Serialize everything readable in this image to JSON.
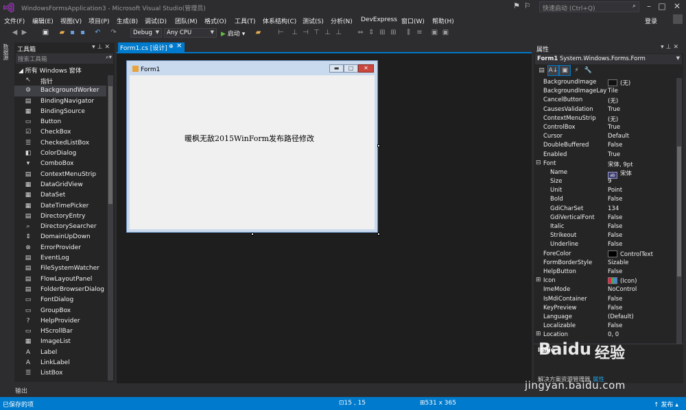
{
  "window": {
    "title": "WindowsFormsApplication3 - Microsoft Visual Studio(管理员)",
    "quick_launch_placeholder": "快速启动 (Ctrl+Q)",
    "login": "登录"
  },
  "menu": [
    "文件(F)",
    "编辑(E)",
    "视图(V)",
    "项目(P)",
    "生成(B)",
    "调试(D)",
    "团队(M)",
    "格式(O)",
    "工具(T)",
    "体系结构(C)",
    "测试(S)",
    "分析(N)",
    "DevExpress",
    "窗口(W)",
    "帮助(H)"
  ],
  "toolbar": {
    "config": "Debug",
    "platform": "Any CPU",
    "start": "启动"
  },
  "side_tab": "数据源",
  "toolbox": {
    "title": "工具箱",
    "search_placeholder": "搜索工具箱",
    "group": "所有 Windows 窗体",
    "items": [
      {
        "icon": "pointer-icon",
        "glyph": "↖",
        "label": "指针"
      },
      {
        "icon": "background-worker-icon",
        "glyph": "⚙",
        "label": "BackgroundWorker"
      },
      {
        "icon": "binding-navigator-icon",
        "glyph": "▤",
        "label": "BindingNavigator"
      },
      {
        "icon": "binding-source-icon",
        "glyph": "▦",
        "label": "BindingSource"
      },
      {
        "icon": "button-icon",
        "glyph": "▭",
        "label": "Button"
      },
      {
        "icon": "checkbox-icon",
        "glyph": "☑",
        "label": "CheckBox"
      },
      {
        "icon": "checked-list-box-icon",
        "glyph": "☰",
        "label": "CheckedListBox"
      },
      {
        "icon": "color-dialog-icon",
        "glyph": "◧",
        "label": "ColorDialog"
      },
      {
        "icon": "combobox-icon",
        "glyph": "▾",
        "label": "ComboBox"
      },
      {
        "icon": "context-menu-strip-icon",
        "glyph": "▤",
        "label": "ContextMenuStrip"
      },
      {
        "icon": "data-grid-view-icon",
        "glyph": "▦",
        "label": "DataGridView"
      },
      {
        "icon": "dataset-icon",
        "glyph": "▦",
        "label": "DataSet"
      },
      {
        "icon": "date-time-picker-icon",
        "glyph": "▦",
        "label": "DateTimePicker"
      },
      {
        "icon": "directory-entry-icon",
        "glyph": "▤",
        "label": "DirectoryEntry"
      },
      {
        "icon": "directory-searcher-icon",
        "glyph": "⌕",
        "label": "DirectorySearcher"
      },
      {
        "icon": "domain-up-down-icon",
        "glyph": "⇕",
        "label": "DomainUpDown"
      },
      {
        "icon": "error-provider-icon",
        "glyph": "⊗",
        "label": "ErrorProvider"
      },
      {
        "icon": "event-log-icon",
        "glyph": "▤",
        "label": "EventLog"
      },
      {
        "icon": "file-system-watcher-icon",
        "glyph": "▤",
        "label": "FileSystemWatcher"
      },
      {
        "icon": "flow-layout-panel-icon",
        "glyph": "▤",
        "label": "FlowLayoutPanel"
      },
      {
        "icon": "folder-browser-dialog-icon",
        "glyph": "▤",
        "label": "FolderBrowserDialog"
      },
      {
        "icon": "font-dialog-icon",
        "glyph": "▭",
        "label": "FontDialog"
      },
      {
        "icon": "groupbox-icon",
        "glyph": "▭",
        "label": "GroupBox"
      },
      {
        "icon": "help-provider-icon",
        "glyph": "?",
        "label": "HelpProvider"
      },
      {
        "icon": "hscrollbar-icon",
        "glyph": "▭",
        "label": "HScrollBar"
      },
      {
        "icon": "image-list-icon",
        "glyph": "▦",
        "label": "ImageList"
      },
      {
        "icon": "label-icon",
        "glyph": "A",
        "label": "Label"
      },
      {
        "icon": "link-label-icon",
        "glyph": "A",
        "label": "LinkLabel"
      },
      {
        "icon": "listbox-icon",
        "glyph": "☰",
        "label": "ListBox"
      }
    ]
  },
  "document": {
    "tab_label": "Form1.cs [设计]",
    "form_title": "Form1",
    "form_label": "暖枫无敌2015WinForm发布路径修改"
  },
  "properties": {
    "title": "属性",
    "object_name": "Form1",
    "object_type": "System.Windows.Forms.Form",
    "rows": [
      {
        "name": "BackgroundImage",
        "value": "(无)",
        "swatch": "dark",
        "expander": "",
        "sub": false
      },
      {
        "name": "BackgroundImageLayout",
        "value": "Tile",
        "swatch": "",
        "expander": "",
        "sub": false
      },
      {
        "name": "CancelButton",
        "value": "(无)",
        "swatch": "",
        "expander": "",
        "sub": false
      },
      {
        "name": "CausesValidation",
        "value": "True",
        "swatch": "",
        "expander": "",
        "sub": false
      },
      {
        "name": "ContextMenuStrip",
        "value": "(无)",
        "swatch": "",
        "expander": "",
        "sub": false
      },
      {
        "name": "ControlBox",
        "value": "True",
        "swatch": "",
        "expander": "",
        "sub": false
      },
      {
        "name": "Cursor",
        "value": "Default",
        "swatch": "",
        "expander": "",
        "sub": false
      },
      {
        "name": "DoubleBuffered",
        "value": "False",
        "swatch": "",
        "expander": "",
        "sub": false
      },
      {
        "name": "Enabled",
        "value": "True",
        "swatch": "",
        "expander": "",
        "sub": false
      },
      {
        "name": "Font",
        "value": "宋体, 9pt",
        "swatch": "",
        "expander": "⊟",
        "sub": false
      },
      {
        "name": "Name",
        "value": "宋体",
        "swatch": "font",
        "expander": "",
        "sub": true
      },
      {
        "name": "Size",
        "value": "9",
        "swatch": "",
        "expander": "",
        "sub": true
      },
      {
        "name": "Unit",
        "value": "Point",
        "swatch": "",
        "expander": "",
        "sub": true
      },
      {
        "name": "Bold",
        "value": "False",
        "swatch": "",
        "expander": "",
        "sub": true
      },
      {
        "name": "GdiCharSet",
        "value": "134",
        "swatch": "",
        "expander": "",
        "sub": true
      },
      {
        "name": "GdiVerticalFont",
        "value": "False",
        "swatch": "",
        "expander": "",
        "sub": true
      },
      {
        "name": "Italic",
        "value": "False",
        "swatch": "",
        "expander": "",
        "sub": true
      },
      {
        "name": "Strikeout",
        "value": "False",
        "swatch": "",
        "expander": "",
        "sub": true
      },
      {
        "name": "Underline",
        "value": "False",
        "swatch": "",
        "expander": "",
        "sub": true
      },
      {
        "name": "ForeColor",
        "value": "ControlText",
        "swatch": "black",
        "expander": "",
        "sub": false
      },
      {
        "name": "FormBorderStyle",
        "value": "Sizable",
        "swatch": "",
        "expander": "",
        "sub": false
      },
      {
        "name": "HelpButton",
        "value": "False",
        "swatch": "",
        "expander": "",
        "sub": false
      },
      {
        "name": "Icon",
        "value": "(Icon)",
        "swatch": "icon",
        "expander": "⊞",
        "sub": false
      },
      {
        "name": "ImeMode",
        "value": "NoControl",
        "swatch": "",
        "expander": "",
        "sub": false
      },
      {
        "name": "IsMdiContainer",
        "value": "False",
        "swatch": "",
        "expander": "",
        "sub": false
      },
      {
        "name": "KeyPreview",
        "value": "False",
        "swatch": "",
        "expander": "",
        "sub": false
      },
      {
        "name": "Language",
        "value": "(Default)",
        "swatch": "",
        "expander": "",
        "sub": false
      },
      {
        "name": "Localizable",
        "value": "False",
        "swatch": "",
        "expander": "",
        "sub": false
      },
      {
        "name": "Location",
        "value": "0, 0",
        "swatch": "",
        "expander": "⊞",
        "sub": false
      }
    ],
    "description_title": "Italic",
    "footer_left": "解决方案资源管理器",
    "footer_right": "属性"
  },
  "output": "输出",
  "status": {
    "left": "已保存的项",
    "position": "15 , 15",
    "size": "531 x 365",
    "publish": "发布"
  },
  "watermark": {
    "brand": "Baidu",
    "jingyan": "经验",
    "url": "jingyan.baidu.com"
  },
  "colors": {
    "accent": "#007acc",
    "background": "#2d2d30",
    "panel": "#252526",
    "designer": "#1e1e1e"
  }
}
